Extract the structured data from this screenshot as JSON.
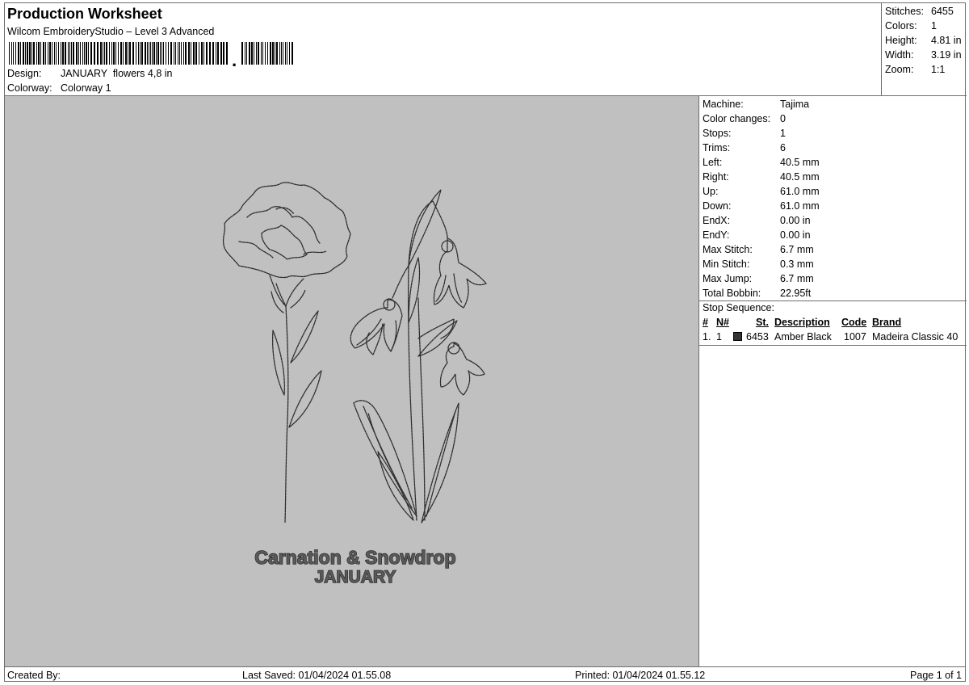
{
  "header": {
    "title": "Production Worksheet",
    "software": "Wilcom EmbroideryStudio – Level 3 Advanced",
    "barcode_suffix": ",",
    "design_label": "Design:",
    "design_value": "JANUARY  flowers 4,8 in",
    "colorway_label": "Colorway:",
    "colorway_value": "Colorway 1"
  },
  "stats": [
    {
      "label": "Stitches:",
      "value": "6455"
    },
    {
      "label": "Colors:",
      "value": "1"
    },
    {
      "label": "Height:",
      "value": "4.81 in"
    },
    {
      "label": "Width:",
      "value": "3.19 in"
    },
    {
      "label": "Zoom:",
      "value": "1:1"
    }
  ],
  "machine_info": [
    {
      "label": "Machine:",
      "value": "Tajima"
    },
    {
      "label": "Color changes:",
      "value": "0"
    },
    {
      "label": "Stops:",
      "value": "1"
    },
    {
      "label": "Trims:",
      "value": "6"
    },
    {
      "label": "Left:",
      "value": "40.5 mm"
    },
    {
      "label": "Right:",
      "value": "40.5 mm"
    },
    {
      "label": "Up:",
      "value": "61.0 mm"
    },
    {
      "label": "Down:",
      "value": "61.0 mm"
    },
    {
      "label": "EndX:",
      "value": "0.00 in"
    },
    {
      "label": "EndY:",
      "value": "0.00 in"
    },
    {
      "label": "Max Stitch:",
      "value": "6.7 mm"
    },
    {
      "label": "Min Stitch:",
      "value": "0.3 mm"
    },
    {
      "label": "Max Jump:",
      "value": "6.7 mm"
    },
    {
      "label": "Total Bobbin:",
      "value": "22.95ft"
    }
  ],
  "stop_sequence": {
    "title": "Stop Sequence:",
    "headers": {
      "index": "#",
      "needle": "N#",
      "stitches": "St.",
      "description": "Description",
      "code": "Code",
      "brand": "Brand"
    },
    "rows": [
      {
        "index": "1.",
        "needle": "1",
        "swatch_color": "#333333",
        "stitches": "6453",
        "description": "Amber Black",
        "code": "1007",
        "brand": "Madeira Classic 40"
      }
    ]
  },
  "design_text": {
    "line1": "Carnation & Snowdrop",
    "line2": "JANUARY"
  },
  "colors": {
    "canvas_bg": "#c0c0c0",
    "stitch": "#2e2e2e"
  },
  "footer": {
    "created_by": "Created By:",
    "last_saved": "Last Saved: 01/04/2024 01.55.08",
    "printed": "Printed: 01/04/2024 01.55.12",
    "page": "Page 1 of 1"
  }
}
